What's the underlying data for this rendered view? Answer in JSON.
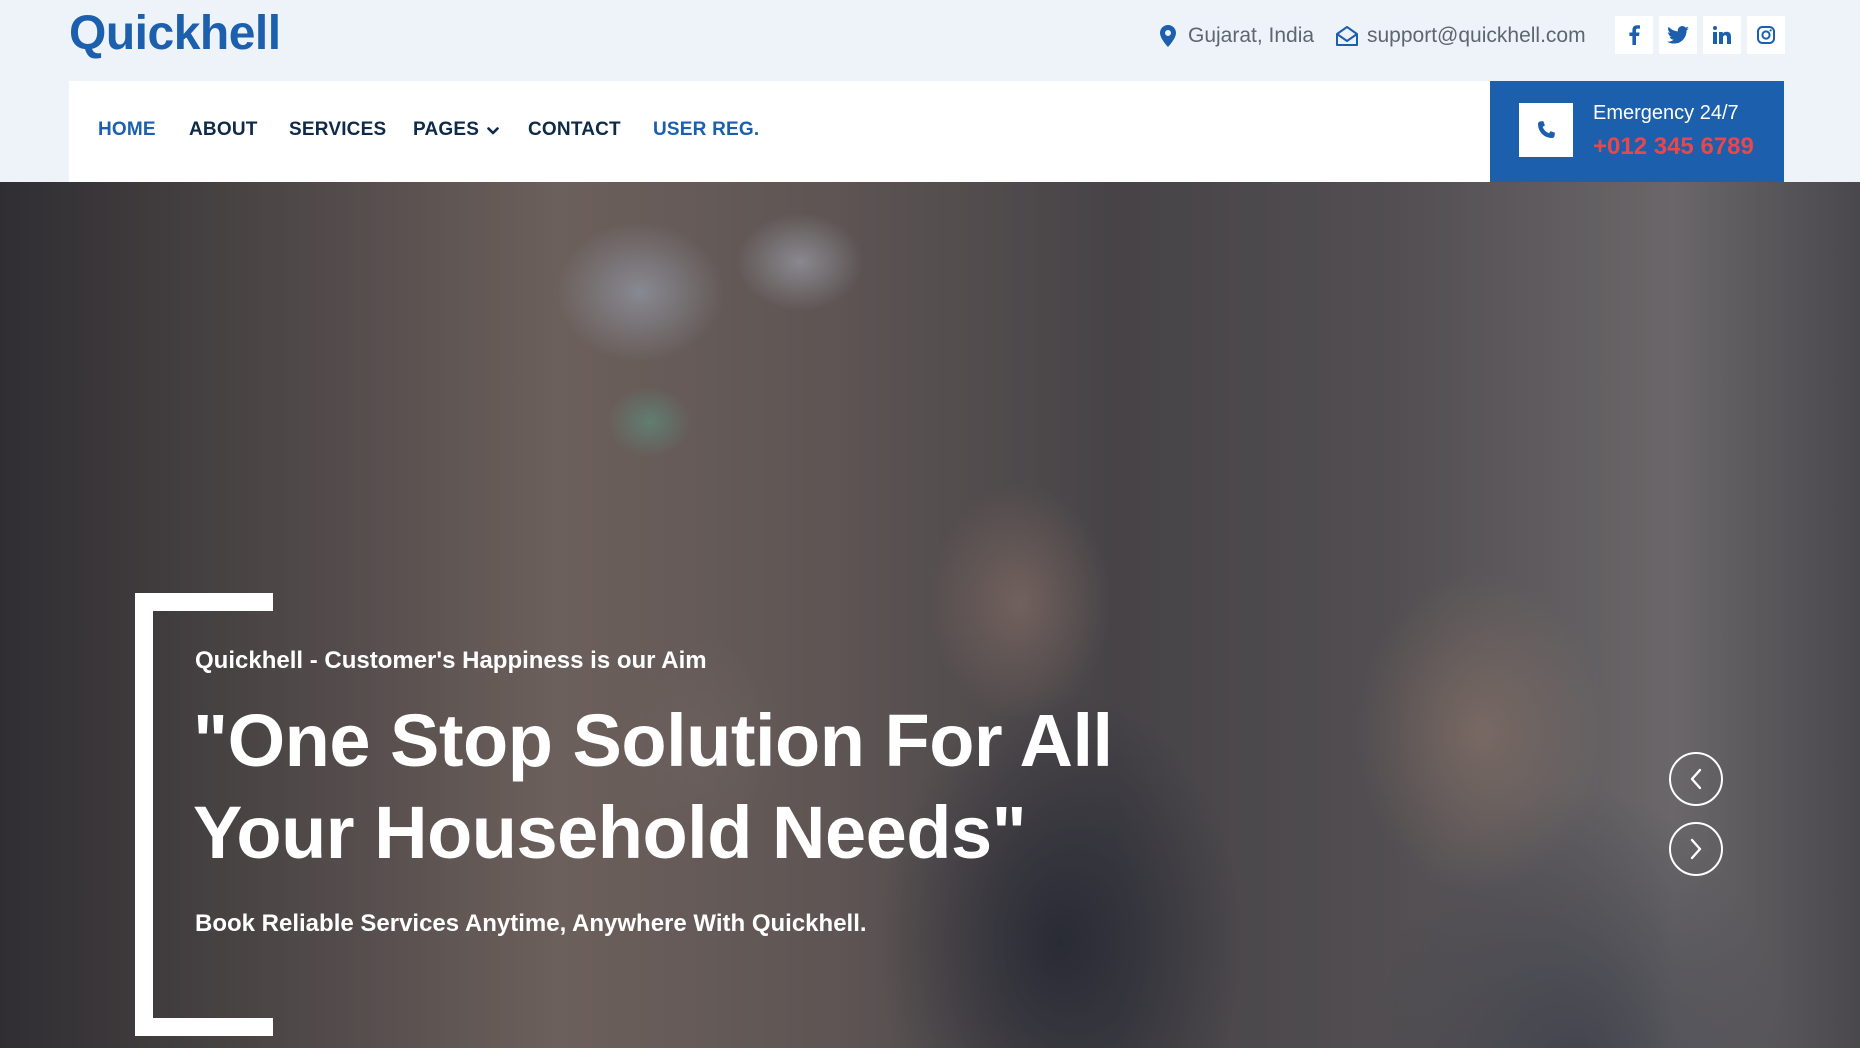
{
  "brand": {
    "name": "Quickhell"
  },
  "topbar": {
    "location": "Gujarat, India",
    "email": "support@quickhell.com",
    "socials": [
      {
        "icon": "facebook-icon",
        "glyph": "f"
      },
      {
        "icon": "twitter-icon",
        "glyph": "t"
      },
      {
        "icon": "linkedin-icon",
        "glyph": "in"
      },
      {
        "icon": "instagram-icon",
        "glyph": "ig"
      }
    ]
  },
  "nav": {
    "items": [
      {
        "label": "HOME",
        "active": true
      },
      {
        "label": "ABOUT"
      },
      {
        "label": "SERVICES"
      },
      {
        "label": "PAGES",
        "has_dropdown": true
      },
      {
        "label": "CONTACT"
      },
      {
        "label": "USER REG."
      }
    ]
  },
  "emergency": {
    "title": "Emergency 24/7",
    "phone": "+012 345 6789"
  },
  "hero": {
    "kicker": "Quickhell - Customer's Happiness is our Aim",
    "headline_line1": "\"One Stop Solution For All",
    "headline_line2": "Your Household Needs\"",
    "subline": "Book Reliable Services Anytime, Anywhere With Quickhell."
  },
  "colors": {
    "brand": "#1c5fad",
    "accent_phone": "#e8474b",
    "nav_text": "#0e2a47",
    "topbar_bg": "#eef2f9"
  }
}
